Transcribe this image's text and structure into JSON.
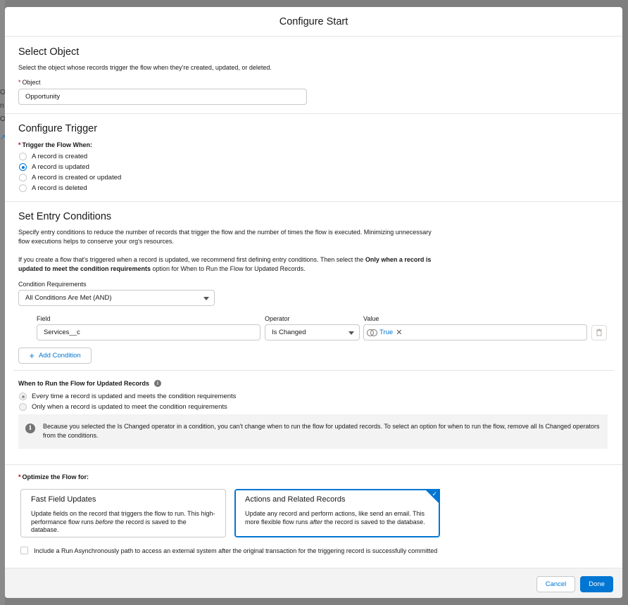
{
  "modal": {
    "title": "Configure Start"
  },
  "select_object": {
    "heading": "Select Object",
    "description": "Select the object whose records trigger the flow when they're created, updated, or deleted.",
    "object_label": "Object",
    "object_value": "Opportunity"
  },
  "configure_trigger": {
    "heading": "Configure Trigger",
    "label": "Trigger the Flow When:",
    "options": [
      {
        "label": "A record is created",
        "checked": false
      },
      {
        "label": "A record is updated",
        "checked": true
      },
      {
        "label": "A record is created or updated",
        "checked": false
      },
      {
        "label": "A record is deleted",
        "checked": false
      }
    ]
  },
  "entry_conditions": {
    "heading": "Set Entry Conditions",
    "desc1_line1": "Specify entry conditions to reduce the number of records that trigger the flow and the number of times the flow is executed. Minimizing unnecessary",
    "desc1_line2": "flow executions helps to conserve your org's resources.",
    "desc2_a": "If you create a flow that's triggered when a record is updated, we recommend first defining entry conditions. Then select the ",
    "desc2_bold1": "Only when a record is",
    "desc2_bold2": "updated to meet the condition requirements",
    "desc2_b": " option for When to Run the Flow for Updated Records.",
    "requirements_label": "Condition Requirements",
    "requirements_value": "All Conditions Are Met (AND)",
    "field_label": "Field",
    "operator_label": "Operator",
    "value_label": "Value",
    "field_value": "Services__c",
    "operator_value": "Is Changed",
    "value_pill": "True",
    "add_condition": "Add Condition"
  },
  "when_to_run": {
    "label": "When to Run the Flow for Updated Records",
    "options": [
      {
        "label": "Every time a record is updated and meets the condition requirements",
        "checked": true
      },
      {
        "label": "Only when a record is updated to meet the condition requirements",
        "checked": false
      }
    ],
    "info": "Because you selected the Is Changed operator in a condition, you can't change when to run the flow for updated records. To select an option for when to run the flow, remove all Is Changed operators from the conditions."
  },
  "optimize": {
    "label": "Optimize the Flow for:",
    "fast": {
      "title": "Fast Field Updates",
      "desc_a": "Update fields on the record that triggers the flow to run. This high-performance flow runs ",
      "desc_em": "before",
      "desc_b": " the record is saved to the database."
    },
    "actions": {
      "title": "Actions and Related Records",
      "desc_a": "Update any record and perform actions, like send an email. This more flexible flow runs ",
      "desc_em": "after",
      "desc_b": " the record is saved to the database."
    },
    "async_label": "Include a Run Asynchronously path to access an external system after the original transaction for the triggering record is successfully committed"
  },
  "footer": {
    "cancel": "Cancel",
    "done": "Done"
  },
  "colors": {
    "brand": "#0176d3",
    "required": "#ba0517"
  }
}
